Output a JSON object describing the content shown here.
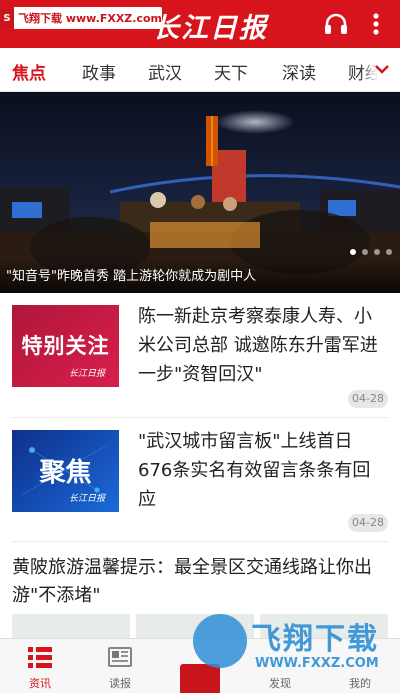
{
  "header": {
    "watermark_badge": "飞翔下载 www.FXXZ.com",
    "brand_title": "长江日报"
  },
  "tabs": [
    {
      "label": "焦点",
      "active": true
    },
    {
      "label": "政事"
    },
    {
      "label": "武汉"
    },
    {
      "label": "天下"
    },
    {
      "label": "深读"
    },
    {
      "label": "财经"
    }
  ],
  "banner": {
    "caption": "\"知音号\"昨晚首秀 踏上游轮你就成为剧中人",
    "slide_count": 4,
    "active_slide": 1
  },
  "news": [
    {
      "thumb_label": "特别关注",
      "thumb_logo": "长江日报",
      "title": "陈一新赴京考察泰康人寿、小米公司总部 诚邀陈东升雷军进一步\"资智回汉\"",
      "date": "04-28"
    },
    {
      "thumb_label": "聚焦",
      "thumb_logo": "长江日报",
      "title": "\"武汉城市留言板\"上线首日676条实名有效留言条条有回应",
      "date": "04-28"
    },
    {
      "title": "黄陂旅游温馨提示：最全景区交通线路让你出游\"不添堵\""
    }
  ],
  "bottom_nav": [
    {
      "label": "资讯",
      "active": true
    },
    {
      "label": "读报"
    },
    {
      "label": ""
    },
    {
      "label": "发现"
    },
    {
      "label": "我的"
    }
  ],
  "watermark": {
    "title": "飞翔下载",
    "url": "WWW.FXXZ.COM"
  },
  "colors": {
    "brand_red": "#d7141b",
    "watermark_blue": "#2f8fd6"
  }
}
